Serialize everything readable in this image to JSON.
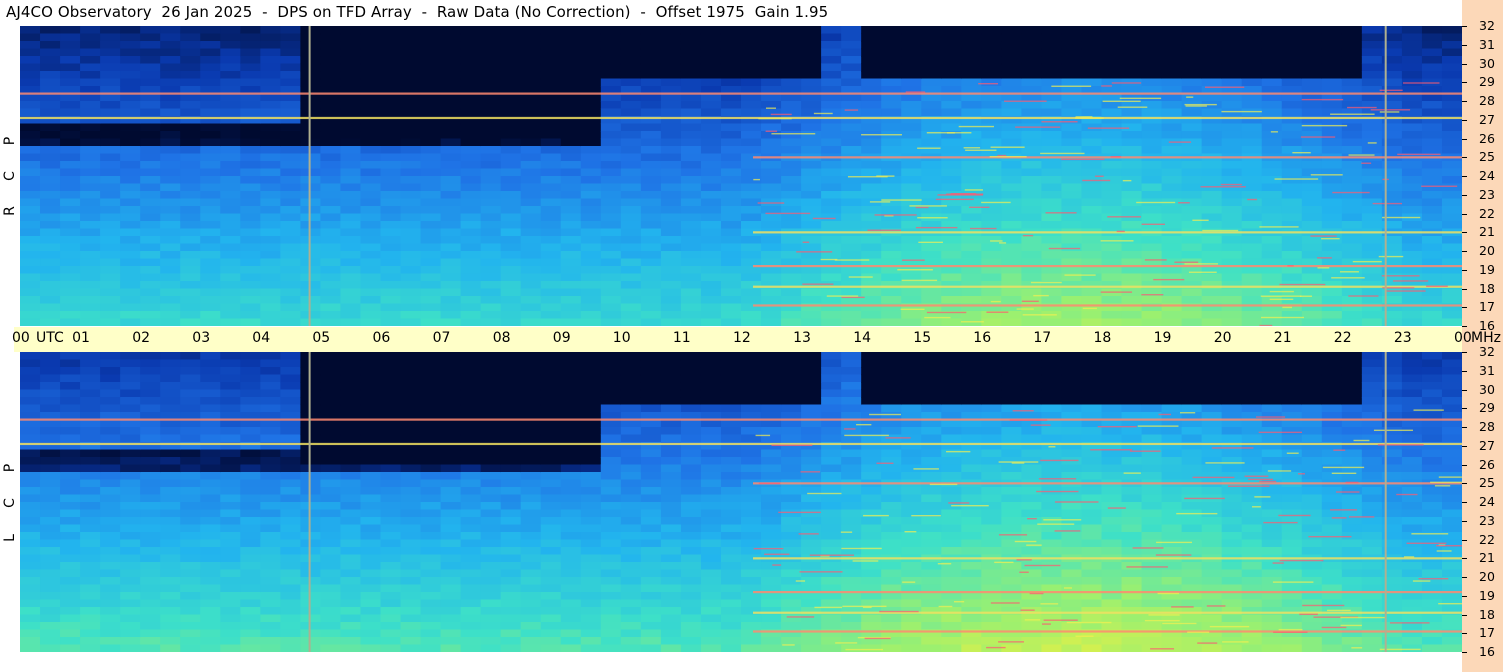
{
  "title": "AJ4CO Observatory  26 Jan 2025  -  DPS on TFD Array  -  Raw Data (No Correction)  -  Offset 1975  Gain 1.95",
  "colors": {
    "time_bar": "#ffffc8",
    "freq_strip": "#fcd8b8",
    "background": "#ffffff",
    "marker_line": "#b0b090"
  },
  "chart_data": [
    {
      "type": "heatmap",
      "polarization": "RCP",
      "polarization_letters": [
        "P",
        "C",
        "R"
      ],
      "x_unit": "UTC",
      "x_range_hours": [
        0,
        24
      ],
      "y_unit": "MHz",
      "ylim": [
        16,
        32
      ],
      "y_ticks": [
        "16",
        "17",
        "18",
        "19",
        "20",
        "21",
        "22",
        "23",
        "24",
        "25",
        "26",
        "27",
        "28",
        "29",
        "30",
        "31",
        "32"
      ],
      "marker_times_utc": [
        4.82,
        22.73
      ],
      "strong_bands_mhz": [
        17.1,
        18.1,
        19.2,
        21.0,
        25.0,
        27.1,
        28.4
      ],
      "colormap": [
        "#000a30",
        "#0a3ab0",
        "#1f73e6",
        "#22b4ee",
        "#3de0c8",
        "#9af070",
        "#f0f040",
        "#ff4040"
      ]
    },
    {
      "type": "heatmap",
      "polarization": "LCP",
      "polarization_letters": [
        "P",
        "C",
        "L"
      ],
      "x_unit": "UTC",
      "x_range_hours": [
        0,
        24
      ],
      "y_unit": "MHz",
      "ylim": [
        16,
        32
      ],
      "y_ticks": [
        "16",
        "17",
        "18",
        "19",
        "20",
        "21",
        "22",
        "23",
        "24",
        "25",
        "26",
        "27",
        "28",
        "29",
        "30",
        "31",
        "32"
      ],
      "marker_times_utc": [
        4.82,
        22.73
      ],
      "strong_bands_mhz": [
        17.1,
        18.1,
        19.2,
        21.0,
        25.0,
        27.1,
        28.4
      ],
      "colormap": [
        "#000a30",
        "#0a3ab0",
        "#1f73e6",
        "#22b4ee",
        "#3de0c8",
        "#9af070",
        "#f0f040",
        "#ff4040"
      ]
    }
  ],
  "time_axis": {
    "labels": [
      "00",
      "01",
      "02",
      "03",
      "04",
      "05",
      "06",
      "07",
      "08",
      "09",
      "10",
      "11",
      "12",
      "13",
      "14",
      "15",
      "16",
      "17",
      "18",
      "19",
      "20",
      "21",
      "22",
      "23",
      "00"
    ],
    "utc_label": "UTC",
    "mhz_label": "MHz"
  }
}
